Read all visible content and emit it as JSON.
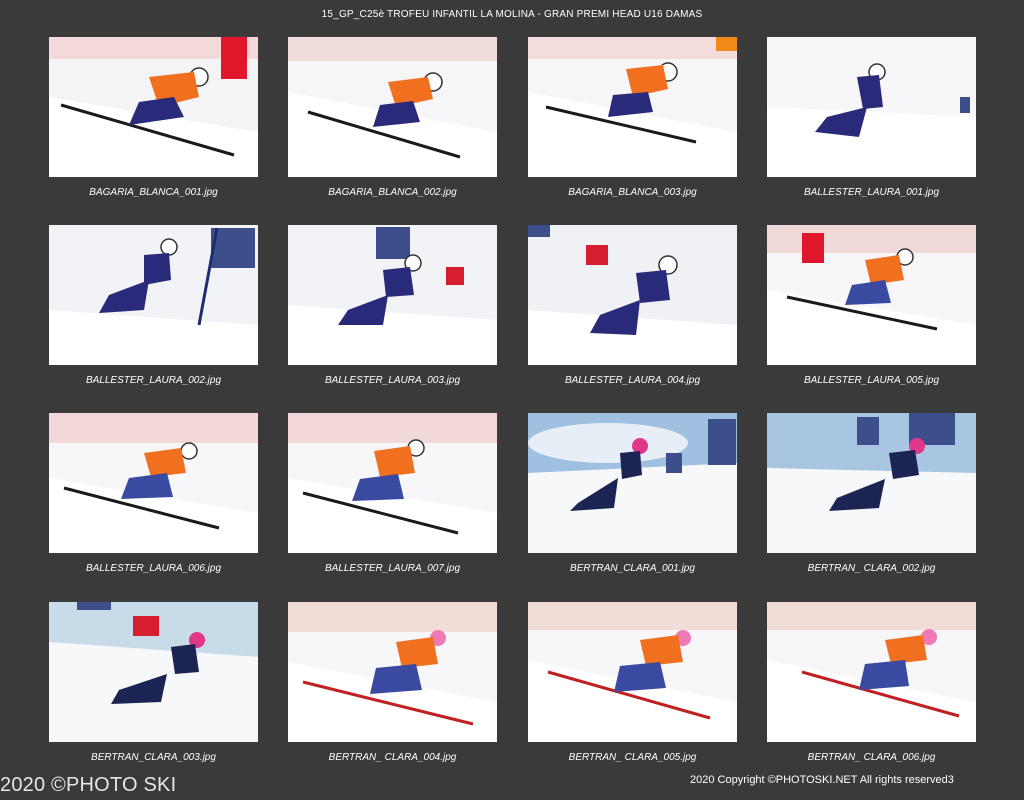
{
  "sheet": {
    "title": "15_GP_C25è TROFEU INFANTIL LA MOLINA - GRAN PREMI HEAD U16 DAMAS"
  },
  "photos": [
    {
      "filename": "BAGARIA_BLANCA_001.jpg"
    },
    {
      "filename": "BAGARIA_BLANCA_002.jpg"
    },
    {
      "filename": "BAGARIA_BLANCA_003.jpg"
    },
    {
      "filename": "BALLESTER_LAURA_001.jpg"
    },
    {
      "filename": "BALLESTER_LAURA_002.jpg"
    },
    {
      "filename": "BALLESTER_LAURA_003.jpg"
    },
    {
      "filename": "BALLESTER_LAURA_004.jpg"
    },
    {
      "filename": "BALLESTER_LAURA_005.jpg"
    },
    {
      "filename": "BALLESTER_LAURA_006.jpg"
    },
    {
      "filename": "BALLESTER_LAURA_007.jpg"
    },
    {
      "filename": "BERTRAN_CLARA_001.jpg"
    },
    {
      "filename": "BERTRAN_ CLARA_002.jpg"
    },
    {
      "filename": "BERTRAN_CLARA_003.jpg"
    },
    {
      "filename": "BERTRAN_ CLARA_004.jpg"
    },
    {
      "filename": "BERTRAN_ CLARA_005.jpg"
    },
    {
      "filename": "BERTRAN_ CLARA_006.jpg"
    }
  ],
  "footer": {
    "watermark": "2020 ©PHOTO SKI",
    "copyright": "2020 Copyright ©PHOTOSKI.NET All rights reserved",
    "page_number": "3"
  }
}
